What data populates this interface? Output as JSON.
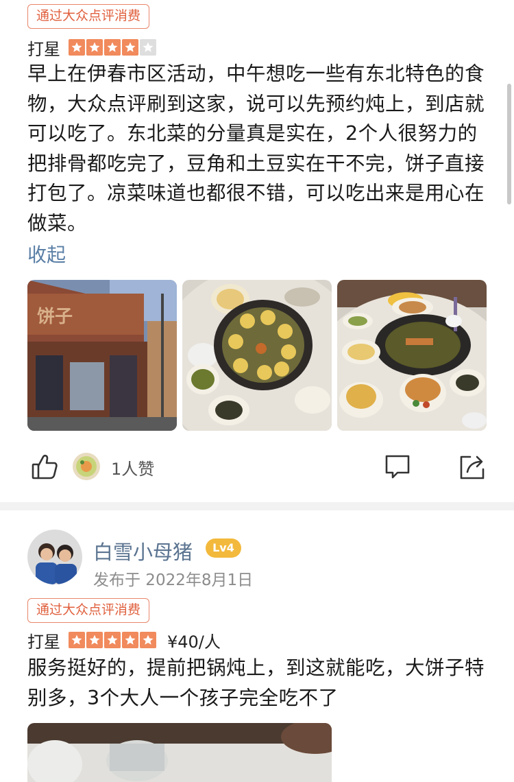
{
  "review1": {
    "badge": "通过大众点评消费",
    "rating_label": "打星",
    "stars": 4,
    "text": "早上在伊春市区活动，中午想吃一些有东北特色的食物，大众点评刷到这家，说可以先预约炖上，到店就可以吃了。东北菜的分量真是实在，2个人很努力的把排骨都吃完了，豆角和土豆实在干不完，饼子直接打包了。凉菜味道也都很不错，可以吃出来是用心在做菜。",
    "collapse": "收起",
    "photos": [
      "restaurant-storefront",
      "stew-pot-with-dumplings",
      "stew-table-spread"
    ],
    "likes": "1人赞"
  },
  "review2": {
    "username": "白雪小母猪",
    "level": "Lv4",
    "date": "发布于 2022年8月1日",
    "badge": "通过大众点评消费",
    "rating_label": "打星",
    "stars": 5,
    "price": "¥40/人",
    "text": "服务挺好的，提前把锅炖上，到这就能吃，大饼子特别多，3个大人一个孩子完全吃不了"
  },
  "colors": {
    "accent": "#e0603e",
    "star": "#f18a5c",
    "link": "#5a7fa6",
    "level": "#f3b93c"
  }
}
